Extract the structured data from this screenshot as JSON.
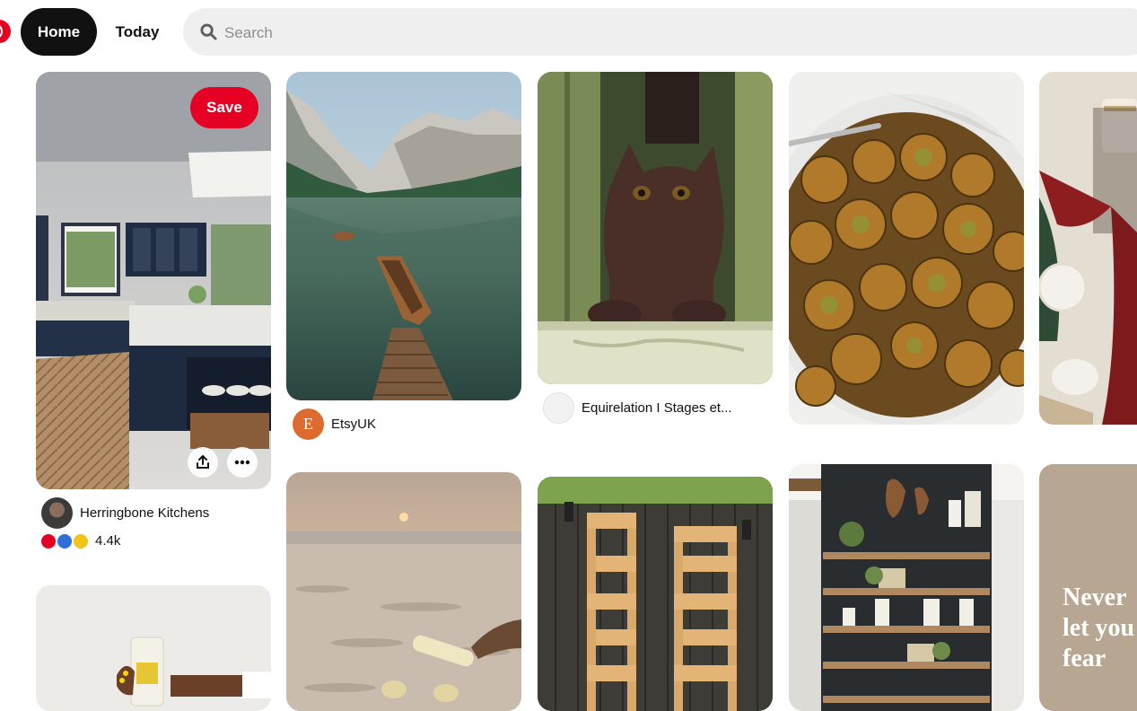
{
  "header": {
    "home_label": "Home",
    "today_label": "Today",
    "search_placeholder": "Search",
    "brand_color": "#e60023"
  },
  "pins": [
    {
      "id": "kitchen",
      "source": "Herringbone Kitchens",
      "reaction_count": "4.4k",
      "save_label": "Save",
      "reactions": [
        "heart-icon",
        "smile-icon",
        "wow-icon"
      ]
    },
    {
      "id": "lake",
      "source": "EtsyUK",
      "avatar_letter": "E"
    },
    {
      "id": "kitten",
      "source": "Equirelation I Stages et..."
    },
    {
      "id": "sprouts"
    },
    {
      "id": "table-setting"
    },
    {
      "id": "drink-can"
    },
    {
      "id": "beach-sunset"
    },
    {
      "id": "garden-planter"
    },
    {
      "id": "shelves"
    },
    {
      "id": "quote",
      "quote_text": [
        "Never",
        "let you",
        "fear"
      ]
    }
  ]
}
